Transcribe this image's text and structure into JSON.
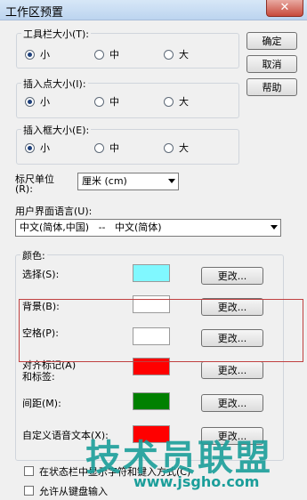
{
  "window": {
    "title": "工作区预置",
    "close_glyph": "✕"
  },
  "buttons": {
    "ok": "确定",
    "cancel": "取消",
    "help": "帮助"
  },
  "toolbar_size": {
    "label": "工具栏大小(T):",
    "options": [
      "小",
      "中",
      "大"
    ],
    "selected": "小"
  },
  "insert_point_size": {
    "label": "插入点大小(I):",
    "options": [
      "小",
      "中",
      "大"
    ],
    "selected": "小"
  },
  "insert_frame_size": {
    "label": "插入框大小(E):",
    "options": [
      "小",
      "中",
      "大"
    ],
    "selected": "小"
  },
  "ruler_unit": {
    "label_line1": "标尺单位",
    "label_line2": "(R):",
    "value": "厘米 (cm)"
  },
  "ui_language": {
    "label": "用户界面语言(U):",
    "value": "中文(简体,中国)   --   中文(简体)"
  },
  "colors": {
    "group_label": "颜色:",
    "change_label": "更改...",
    "items": [
      {
        "label": "选择(S):",
        "color": "#80f8ff"
      },
      {
        "label": "背景(B):",
        "color": "#ffffff"
      },
      {
        "label": "空格(P):",
        "color": "#ffffff"
      },
      {
        "label": "对齐标记(A)\n和标签:",
        "color": "#ff0000"
      },
      {
        "label": "间距(M):",
        "color": "#008000"
      },
      {
        "label": "自定义语音文本(X):",
        "color": "#ff0000"
      }
    ]
  },
  "checkboxes": [
    {
      "label": "在状态栏中显示字符和键入方式(C)",
      "checked": false
    },
    {
      "label": "允许从键盘输入",
      "checked": false
    }
  ],
  "watermark": {
    "text": "技术员联盟",
    "url": "www.jsgho.com"
  }
}
